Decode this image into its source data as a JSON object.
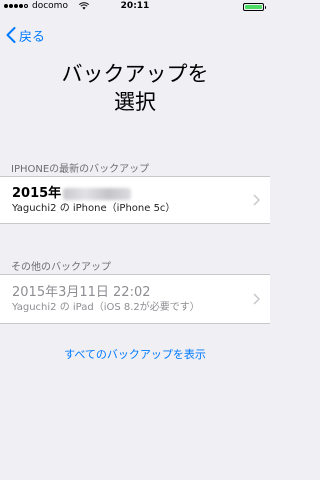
{
  "status_bar": {
    "carrier": "docomo",
    "time": "20:11",
    "signal_bars_filled": 4,
    "signal_bars_total": 5,
    "battery_level": 1.0
  },
  "nav": {
    "back_label": "戻る"
  },
  "page": {
    "title": "バックアップを\n選択"
  },
  "sections": {
    "iphone_latest": {
      "header": "IPHONEの最新のバックアップ",
      "row": {
        "title": "2015年",
        "subtitle": "Yaguchi2 の iPhone（iPhone 5c）"
      }
    },
    "other": {
      "header": "その他のバックアップ",
      "row": {
        "title": "2015年3月11日 22:02",
        "subtitle": "Yaguchi2 の iPad（iOS 8.2が必要です）"
      }
    }
  },
  "footer": {
    "show_all_label": "すべてのバックアップを表示"
  },
  "colors": {
    "accent": "#007aff",
    "background": "#efeff4",
    "secondary_text": "#8e8e93",
    "battery": "#4cd964"
  }
}
